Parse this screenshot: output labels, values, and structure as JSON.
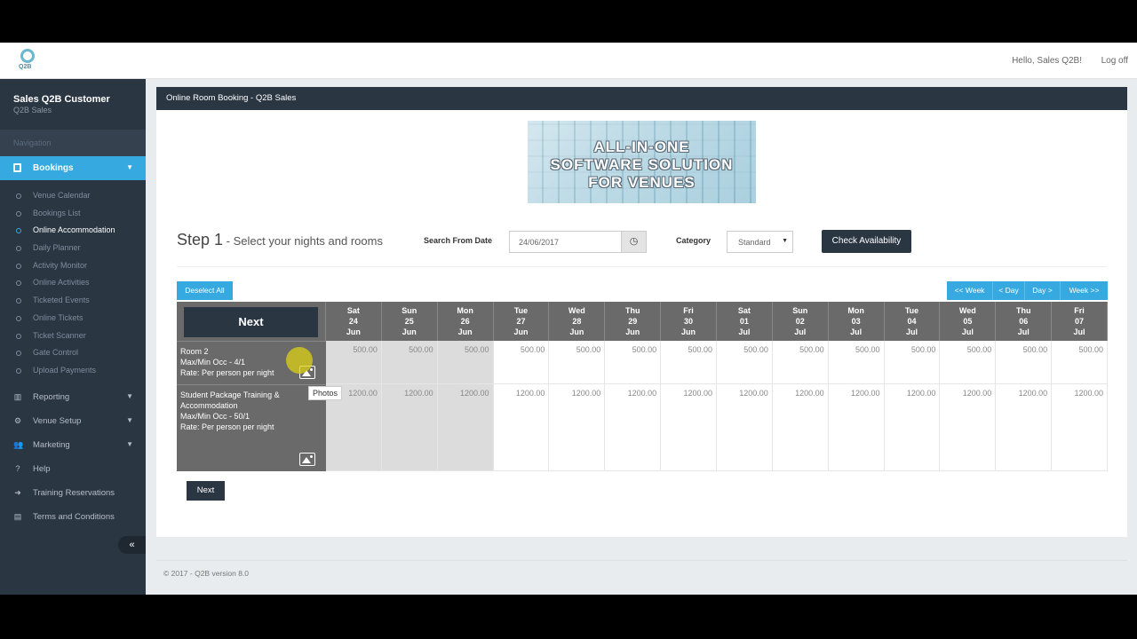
{
  "header": {
    "greeting": "Hello, Sales Q2B!",
    "logoff": "Log off",
    "logo_text": "Q2B"
  },
  "sidebar": {
    "user_name": "Sales Q2B Customer",
    "company": "Q2B Sales",
    "nav_header": "Navigation",
    "bookings_label": "Bookings",
    "bookings_sub": [
      {
        "label": "Venue Calendar"
      },
      {
        "label": "Bookings List"
      },
      {
        "label": "Online Accommodation",
        "active": true
      },
      {
        "label": "Daily Planner"
      },
      {
        "label": "Activity Monitor"
      },
      {
        "label": "Online Activities"
      },
      {
        "label": "Ticketed Events"
      },
      {
        "label": "Online Tickets"
      },
      {
        "label": "Ticket Scanner"
      },
      {
        "label": "Gate Control"
      },
      {
        "label": "Upload Payments"
      }
    ],
    "items": [
      {
        "label": "Reporting",
        "icon": "bar-chart-icon",
        "caret": true
      },
      {
        "label": "Venue Setup",
        "icon": "cog-icon",
        "caret": true
      },
      {
        "label": "Marketing",
        "icon": "users-icon",
        "caret": true
      },
      {
        "label": "Help",
        "icon": "question-icon",
        "caret": false
      },
      {
        "label": "Training Reservations",
        "icon": "arrow-circle-icon",
        "caret": false
      },
      {
        "label": "Terms and Conditions",
        "icon": "document-icon",
        "caret": false
      }
    ]
  },
  "panel": {
    "title": "Online Room Booking - Q2B Sales",
    "banner_lines": [
      "ALL-IN-ONE",
      "SOFTWARE SOLUTION",
      "FOR VENUES"
    ],
    "step_title": "Step 1",
    "step_sub": " - Select your nights and rooms",
    "search_from_label": "Search From Date",
    "search_from_value": "24/06/2017",
    "category_label": "Category",
    "category_value": "Standard",
    "check_button": "Check Availability",
    "deselect_button": "Deselect All",
    "nav_buttons": [
      "<< Week",
      "< Day",
      "Day >",
      "Week >>"
    ],
    "grid_next": "Next",
    "bottom_next": "Next",
    "tooltip": "Photos"
  },
  "grid": {
    "dates": [
      {
        "dow": "Sat",
        "day": "24",
        "mon": "Jun"
      },
      {
        "dow": "Sun",
        "day": "25",
        "mon": "Jun"
      },
      {
        "dow": "Mon",
        "day": "26",
        "mon": "Jun"
      },
      {
        "dow": "Tue",
        "day": "27",
        "mon": "Jun"
      },
      {
        "dow": "Wed",
        "day": "28",
        "mon": "Jun"
      },
      {
        "dow": "Thu",
        "day": "29",
        "mon": "Jun"
      },
      {
        "dow": "Fri",
        "day": "30",
        "mon": "Jun"
      },
      {
        "dow": "Sat",
        "day": "01",
        "mon": "Jul"
      },
      {
        "dow": "Sun",
        "day": "02",
        "mon": "Jul"
      },
      {
        "dow": "Mon",
        "day": "03",
        "mon": "Jul"
      },
      {
        "dow": "Tue",
        "day": "04",
        "mon": "Jul"
      },
      {
        "dow": "Wed",
        "day": "05",
        "mon": "Jul"
      },
      {
        "dow": "Thu",
        "day": "06",
        "mon": "Jul"
      },
      {
        "dow": "Fri",
        "day": "07",
        "mon": "Jul"
      }
    ],
    "rooms": [
      {
        "lines": [
          "Room 2",
          "Max/Min Occ - 4/1",
          "Rate: Per person per night"
        ],
        "rates": [
          "500.00",
          "500.00",
          "500.00",
          "500.00",
          "500.00",
          "500.00",
          "500.00",
          "500.00",
          "500.00",
          "500.00",
          "500.00",
          "500.00",
          "500.00",
          "500.00"
        ],
        "shaded": 3
      },
      {
        "lines": [
          "Student Package Training &",
          "Accommodation",
          "Max/Min Occ - 50/1",
          "Rate: Per person per night"
        ],
        "rates": [
          "1200.00",
          "1200.00",
          "1200.00",
          "1200.00",
          "1200.00",
          "1200.00",
          "1200.00",
          "1200.00",
          "1200.00",
          "1200.00",
          "1200.00",
          "1200.00",
          "1200.00",
          "1200.00"
        ],
        "shaded": 3
      }
    ]
  },
  "footer": "© 2017 - Q2B version 8.0"
}
